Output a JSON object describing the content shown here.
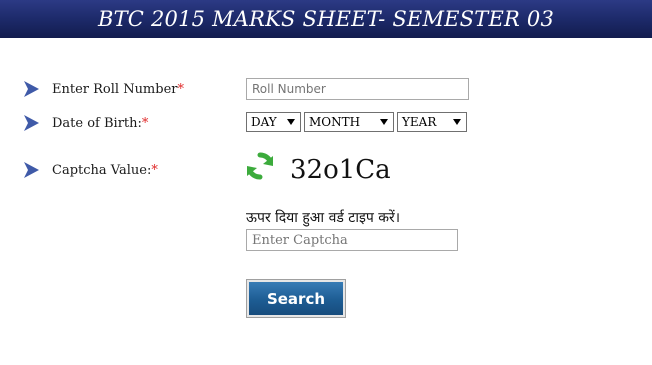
{
  "header": {
    "title": "BTC 2015 MARKS SHEET- SEMESTER 03"
  },
  "form": {
    "roll_number": {
      "label": "Enter Roll Number",
      "required_mark": "*",
      "placeholder": "Roll Number"
    },
    "dob": {
      "label": "Date of Birth:",
      "required_mark": "*",
      "day": "DAY",
      "month": "MONTH",
      "year": "YEAR"
    },
    "captcha": {
      "label": "Captcha Value:",
      "required_mark": "*",
      "value": "32o1Ca",
      "hint": "ऊपर दिया हुआ वर्ड टाइप करें।",
      "placeholder": "Enter Captcha"
    },
    "search_label": "Search"
  },
  "colors": {
    "header_bg": "#1d2a6a",
    "required": "#e02a2a",
    "button_bg": "#1d5c93",
    "arrow": "#3f5aa8",
    "refresh_icon": "#3cab3c"
  },
  "icons": {
    "bullet": "arrow-bullet-icon",
    "refresh": "refresh-icon"
  }
}
